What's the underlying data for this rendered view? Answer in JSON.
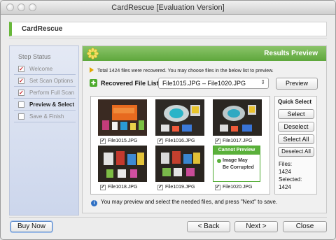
{
  "window": {
    "title": "CardRescue [Evaluation Version]"
  },
  "header": {
    "title": "CardRescue"
  },
  "sidebar": {
    "heading": "Step Status",
    "steps": [
      {
        "label": "Welcome",
        "checked": true
      },
      {
        "label": "Set Scan Options",
        "checked": true
      },
      {
        "label": "Perform Full Scan",
        "checked": true
      },
      {
        "label": "Preview & Select",
        "checked": false,
        "active": true
      },
      {
        "label": "Save & Finish",
        "checked": false
      }
    ]
  },
  "main": {
    "banner_title": "Results Preview",
    "info_text": "Total 1424 files were recovered. You may choose files in the below list to preview.",
    "recovered_label": "Recovered File List",
    "file_range": "File1015.JPG – File1020.JPG",
    "preview_button": "Preview",
    "files": [
      {
        "name": "File1015.JPG",
        "checked": true
      },
      {
        "name": "File1016.JPG",
        "checked": true
      },
      {
        "name": "File1017.JPG",
        "checked": true
      },
      {
        "name": "File1018.JPG",
        "checked": true
      },
      {
        "name": "File1019.JPG",
        "checked": true
      },
      {
        "name": "File1020.JPG",
        "checked": true
      }
    ],
    "cannot_preview": {
      "title": "Cannot Preview",
      "line1": "Image May",
      "line2": "Be Corrupted"
    },
    "quick_select": {
      "title": "Quick Select",
      "select": "Select",
      "deselect": "Deselect",
      "select_all": "Select All",
      "deselect_all": "Deselect All",
      "files_label": "Files:",
      "files_count": "1424",
      "selected_label": "Selected:",
      "selected_count": "1424"
    },
    "hint": "You may preview and select the needed files, and press \"Next\" to save."
  },
  "footer": {
    "buy_now": "Buy Now",
    "back": "< Back",
    "next": "Next >",
    "close": "Close"
  }
}
